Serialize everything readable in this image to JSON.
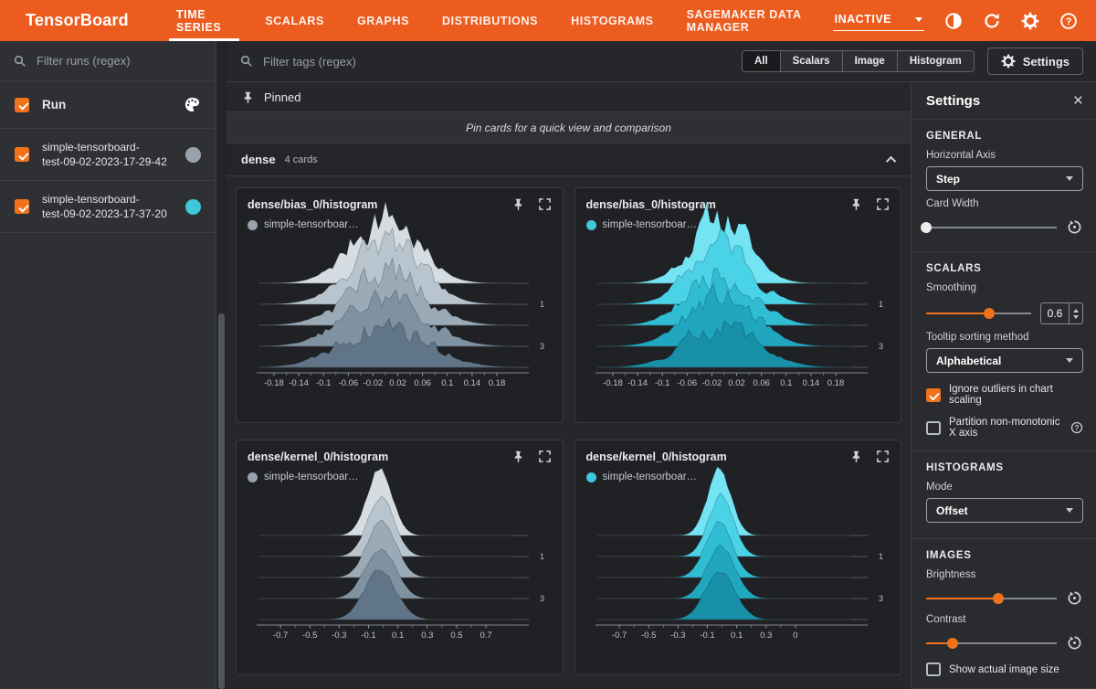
{
  "colors": {
    "brand_orange": "#EB5C1E",
    "accent_orange": "#F0731C",
    "sidebar_bg": "#2F3033",
    "main_bg": "#26272A",
    "card_bg": "#202124",
    "panel_bg": "#2A2B2E",
    "border": "#3C3D40",
    "text_primary": "#E8EAED"
  },
  "header": {
    "logo": "TensorBoard",
    "tabs": [
      {
        "label": "TIME SERIES",
        "active": true
      },
      {
        "label": "SCALARS",
        "active": false
      },
      {
        "label": "GRAPHS",
        "active": false
      },
      {
        "label": "DISTRIBUTIONS",
        "active": false
      },
      {
        "label": "HISTOGRAMS",
        "active": false
      },
      {
        "label": "SAGEMAKER DATA MANAGER",
        "active": false
      }
    ],
    "status": "INACTIVE"
  },
  "sidebar": {
    "filter_placeholder": "Filter runs (regex)",
    "runs_header_label": "Run",
    "runs": [
      {
        "name_line1": "simple-tensorboard-",
        "name_line2": "test-09-02-2023-17-29-42",
        "color": "#9AA3AD",
        "checked": true
      },
      {
        "name_line1": "simple-tensorboard-",
        "name_line2": "test-09-02-2023-17-37-20",
        "color": "#3FC8DC",
        "checked": true
      }
    ]
  },
  "toolbar": {
    "filter_tags_placeholder": "Filter tags (regex)",
    "filters": [
      {
        "label": "All",
        "active": true
      },
      {
        "label": "Scalars",
        "active": false
      },
      {
        "label": "Image",
        "active": false
      },
      {
        "label": "Histogram",
        "active": false
      }
    ],
    "settings_label": "Settings"
  },
  "pinned": {
    "label": "Pinned",
    "hint": "Pin cards for a quick view and comparison"
  },
  "section": {
    "name": "dense",
    "count_label": "4 cards"
  },
  "chart_data": [
    {
      "type": "ridgeline-histogram",
      "title": "dense/bias_0/histogram",
      "run": "simple-tensorboar…",
      "run_color": "#9AA3AD",
      "x_domain": [
        -0.205,
        0.205
      ],
      "x_ticks": [
        {
          "label": "-0.18",
          "v": -0.18
        },
        {
          "label": "-0.14",
          "v": -0.14
        },
        {
          "label": "-0.1",
          "v": -0.1
        },
        {
          "label": "-0.06",
          "v": -0.06
        },
        {
          "label": "-0.02",
          "v": -0.02
        },
        {
          "label": "0.02",
          "v": 0.02
        },
        {
          "label": "0.06",
          "v": 0.06
        },
        {
          "label": "0.1",
          "v": 0.1
        },
        {
          "label": "0.14",
          "v": 0.14
        },
        {
          "label": "0.18",
          "v": 0.18
        }
      ],
      "step_labels": [
        {
          "label": "1",
          "layer": 1
        },
        {
          "label": "3",
          "layer": 3
        }
      ],
      "layer_colors": [
        "#D5DDE3",
        "#B9C5CE",
        "#9BAAB7",
        "#7E92A1",
        "#617588"
      ],
      "amp_back": 74,
      "amp_front": 46,
      "sigma": 0.052,
      "center": 0.0,
      "noise": 0.55,
      "seed": 7
    },
    {
      "type": "ridgeline-histogram",
      "title": "dense/bias_0/histogram",
      "run": "simple-tensorboar…",
      "run_color": "#3FC8DC",
      "x_domain": [
        -0.205,
        0.205
      ],
      "x_ticks": [
        {
          "label": "-0.18",
          "v": -0.18
        },
        {
          "label": "-0.14",
          "v": -0.14
        },
        {
          "label": "-0.1",
          "v": -0.1
        },
        {
          "label": "-0.06",
          "v": -0.06
        },
        {
          "label": "-0.02",
          "v": -0.02
        },
        {
          "label": "0.02",
          "v": 0.02
        },
        {
          "label": "0.06",
          "v": 0.06
        },
        {
          "label": "0.1",
          "v": 0.1
        },
        {
          "label": "0.14",
          "v": 0.14
        },
        {
          "label": "0.18",
          "v": 0.18
        }
      ],
      "step_labels": [
        {
          "label": "1",
          "layer": 1
        },
        {
          "label": "3",
          "layer": 3
        }
      ],
      "layer_colors": [
        "#74E4F4",
        "#4AD2E6",
        "#30BDD4",
        "#21A6BF",
        "#1790A8"
      ],
      "amp_back": 74,
      "amp_front": 46,
      "sigma": 0.045,
      "center": -0.005,
      "noise": 0.5,
      "seed": 11
    },
    {
      "type": "ridgeline-histogram",
      "title": "dense/kernel_0/histogram",
      "run": "simple-tensorboar…",
      "run_color": "#9AA3AD",
      "x_domain": [
        -0.85,
        0.88
      ],
      "x_ticks": [
        {
          "label": "-0.7",
          "v": -0.7
        },
        {
          "label": "-0.5",
          "v": -0.5
        },
        {
          "label": "-0.3",
          "v": -0.3
        },
        {
          "label": "-0.1",
          "v": -0.1
        },
        {
          "label": "0.1",
          "v": 0.1
        },
        {
          "label": "0.3",
          "v": 0.3
        },
        {
          "label": "0.5",
          "v": 0.5
        },
        {
          "label": "0.7",
          "v": 0.7
        }
      ],
      "step_labels": [
        {
          "label": "1",
          "layer": 1
        },
        {
          "label": "3",
          "layer": 3
        }
      ],
      "layer_colors": [
        "#D5DDE3",
        "#B9C5CE",
        "#9BAAB7",
        "#7E92A1",
        "#617588"
      ],
      "amp_back": 72,
      "amp_front": 52,
      "sigma": 0.085,
      "center": -0.02,
      "noise": 0.12,
      "seed": 5
    },
    {
      "type": "ridgeline-histogram",
      "title": "dense/kernel_0/histogram",
      "run": "simple-tensorboar…",
      "run_color": "#3FC8DC",
      "x_domain": [
        -0.85,
        0.88
      ],
      "x_ticks": [
        {
          "label": "-0.7",
          "v": -0.7
        },
        {
          "label": "-0.5",
          "v": -0.5
        },
        {
          "label": "-0.3",
          "v": -0.3
        },
        {
          "label": "-0.1",
          "v": -0.1
        },
        {
          "label": "0.1",
          "v": 0.1
        },
        {
          "label": "0.3",
          "v": 0.3
        },
        {
          "label": "0",
          "v": 0.5
        }
      ],
      "step_labels": [
        {
          "label": "1",
          "layer": 1
        },
        {
          "label": "3",
          "layer": 3
        }
      ],
      "layer_colors": [
        "#74E4F4",
        "#4AD2E6",
        "#30BDD4",
        "#21A6BF",
        "#1790A8"
      ],
      "amp_back": 72,
      "amp_front": 52,
      "sigma": 0.08,
      "center": -0.015,
      "noise": 0.12,
      "seed": 9
    }
  ],
  "settings": {
    "title": "Settings",
    "general": {
      "heading": "GENERAL",
      "horizontal_axis_label": "Horizontal Axis",
      "horizontal_axis_value": "Step",
      "card_width_label": "Card Width",
      "card_width_percent": 0
    },
    "scalars": {
      "heading": "SCALARS",
      "smoothing_label": "Smoothing",
      "smoothing_value": "0.6",
      "smoothing_percent": 60,
      "tooltip_label": "Tooltip sorting method",
      "tooltip_value": "Alphabetical",
      "ignore_outliers_label": "Ignore outliers in chart scaling",
      "ignore_outliers_checked": true,
      "partition_label": "Partition non-monotonic X axis",
      "partition_checked": false
    },
    "histograms": {
      "heading": "HISTOGRAMS",
      "mode_label": "Mode",
      "mode_value": "Offset"
    },
    "images": {
      "heading": "IMAGES",
      "brightness_label": "Brightness",
      "brightness_percent": 55,
      "contrast_label": "Contrast",
      "contrast_percent": 20,
      "show_actual_label": "Show actual image size",
      "show_actual_checked": false
    }
  }
}
